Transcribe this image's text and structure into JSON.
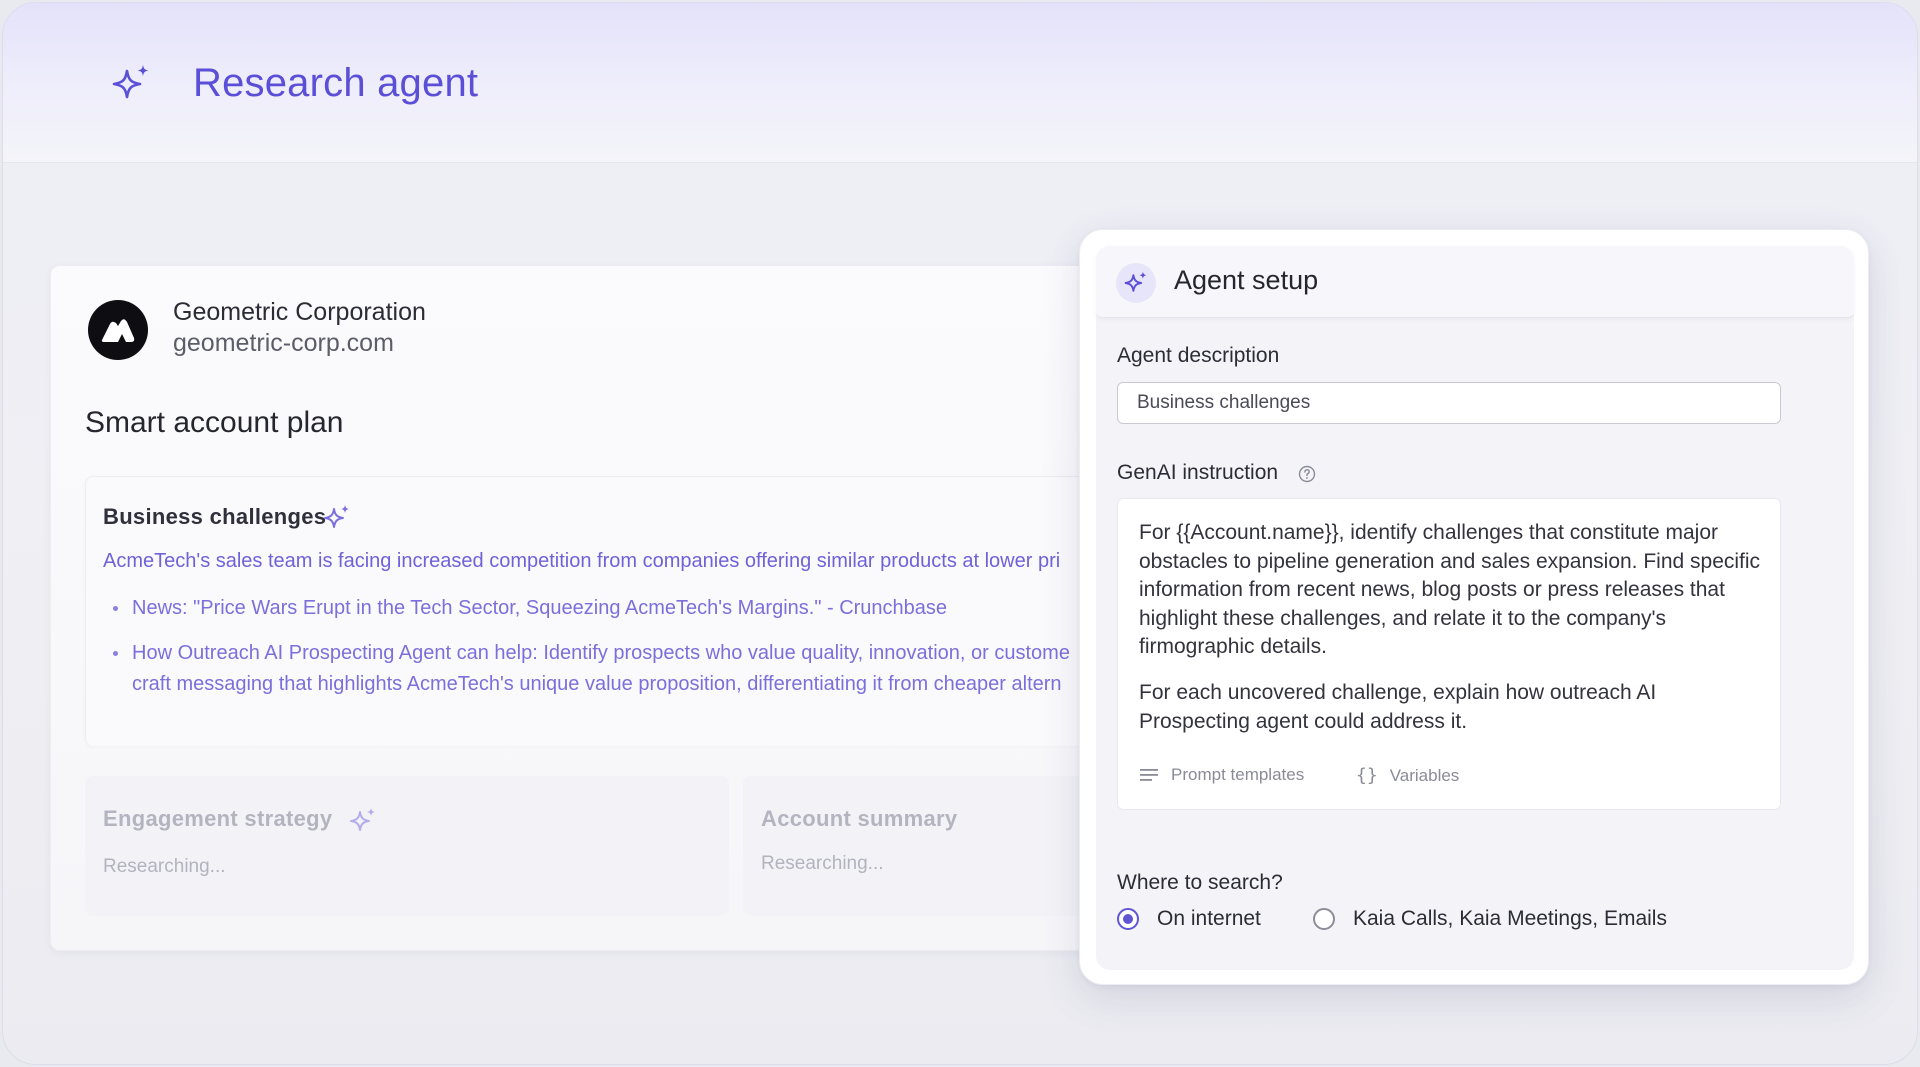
{
  "header": {
    "title": "Research agent",
    "icon": "sparkle-icon"
  },
  "account": {
    "company_name": "Geometric Corporation",
    "domain": "geometric-corp.com",
    "plan_title": "Smart account plan",
    "business_challenges": {
      "title": "Business challenges",
      "lead": "AcmeTech's sales team is facing increased competition from companies offering similar products at lower pri",
      "bullets": [
        "News: \"Price Wars Erupt in the Tech Sector, Squeezing AcmeTech's Margins.\" - Crunchbase",
        "How Outreach AI Prospecting Agent can help: Identify prospects who value quality, innovation, or custome\ncraft messaging that highlights AcmeTech's unique value proposition, differentiating it from cheaper altern"
      ]
    },
    "engagement_strategy": {
      "title": "Engagement strategy",
      "status": "Researching..."
    },
    "account_summary": {
      "title": "Account summary",
      "status": "Researching..."
    }
  },
  "agent_setup": {
    "title": "Agent setup",
    "description_label": "Agent description",
    "description_value": "Business challenges",
    "instruction_label": "GenAI instruction",
    "instruction_paragraph_1": "For {{Account.name}}, identify challenges that constitute major obstacles to pipeline generation and sales expansion. Find specific information from recent news, blog posts or press releases that highlight these challenges, and relate it to the company's firmographic details.",
    "instruction_paragraph_2": "For each uncovered challenge, explain how outreach AI Prospecting agent could address it.",
    "prompt_templates_label": "Prompt templates",
    "variables_label": "Variables",
    "search_label": "Where to search?",
    "search_options": [
      "On internet",
      "Kaia Calls, Kaia Meetings, Emails"
    ],
    "selected_search_option": "On internet"
  },
  "colors": {
    "accent": "#5a4fd6",
    "link": "#6f62d8",
    "muted": "#b4b4c0"
  }
}
